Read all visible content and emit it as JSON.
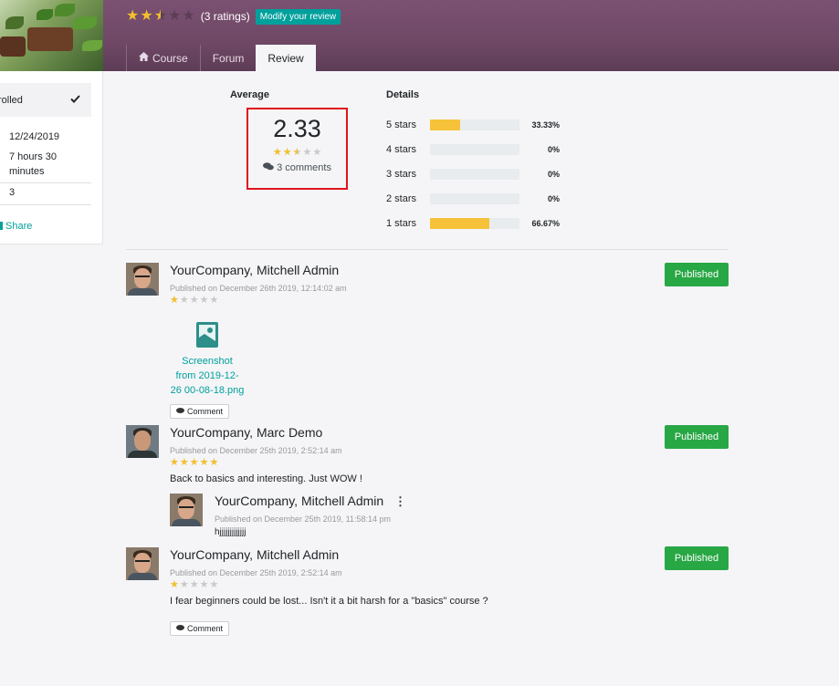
{
  "header": {
    "course_rating": 2.5,
    "ratings_count": "(3 ratings)",
    "modify_label": "Modify your review",
    "tabs": [
      {
        "label": "Course",
        "icon": "home-icon",
        "active": false
      },
      {
        "label": "Forum",
        "active": false
      },
      {
        "label": "Review",
        "active": true
      }
    ]
  },
  "sidebar": {
    "status": "rolled",
    "last_update": "12/24/2019",
    "duration_line1": "7 hours 30",
    "duration_line2": "minutes",
    "members": "3",
    "share_label": "Share"
  },
  "stats": {
    "average_label": "Average",
    "average_value": "2.33",
    "average_rating": 2.33,
    "comments_label": "3 comments",
    "details_label": "Details",
    "breakdown": [
      {
        "label": "5 stars",
        "percent": 33.33,
        "percent_text": "33.33%"
      },
      {
        "label": "4 stars",
        "percent": 0,
        "percent_text": "0%"
      },
      {
        "label": "3 stars",
        "percent": 0,
        "percent_text": "0%"
      },
      {
        "label": "2 stars",
        "percent": 0,
        "percent_text": "0%"
      },
      {
        "label": "1 stars",
        "percent": 66.67,
        "percent_text": "66.67%"
      }
    ]
  },
  "reviews": [
    {
      "author": "YourCompany, Mitchell Admin",
      "date": "Published on December 26th 2019, 12:14:02 am",
      "rating": 1,
      "status": "Published",
      "attachment_line1": "Screenshot",
      "attachment_line2": "from 2019-12-",
      "attachment_line3": "26 00-08-18.png",
      "comment_label": "Comment"
    },
    {
      "author": "YourCompany, Marc Demo",
      "date": "Published on December 25th 2019, 2:52:14 am",
      "rating": 5,
      "status": "Published",
      "text": "Back to basics and interesting. Just WOW !",
      "reply": {
        "author": "YourCompany, Mitchell Admin",
        "date": "Published on December 25th 2019, 11:58:14 pm",
        "text": "hjjjjjjjjjjjjj"
      }
    },
    {
      "author": "YourCompany, Mitchell Admin",
      "date": "Published on December 25th 2019, 2:52:14 am",
      "rating": 1,
      "status": "Published",
      "text": "I fear beginners could be lost... Isn't it a bit harsh for a \"basics\" course ?",
      "comment_label": "Comment"
    }
  ],
  "colors": {
    "header": "#6f4866",
    "star": "#f3c12d",
    "accent": "#00a09d",
    "published": "#28a745",
    "highlight_box": "#e0141e"
  }
}
